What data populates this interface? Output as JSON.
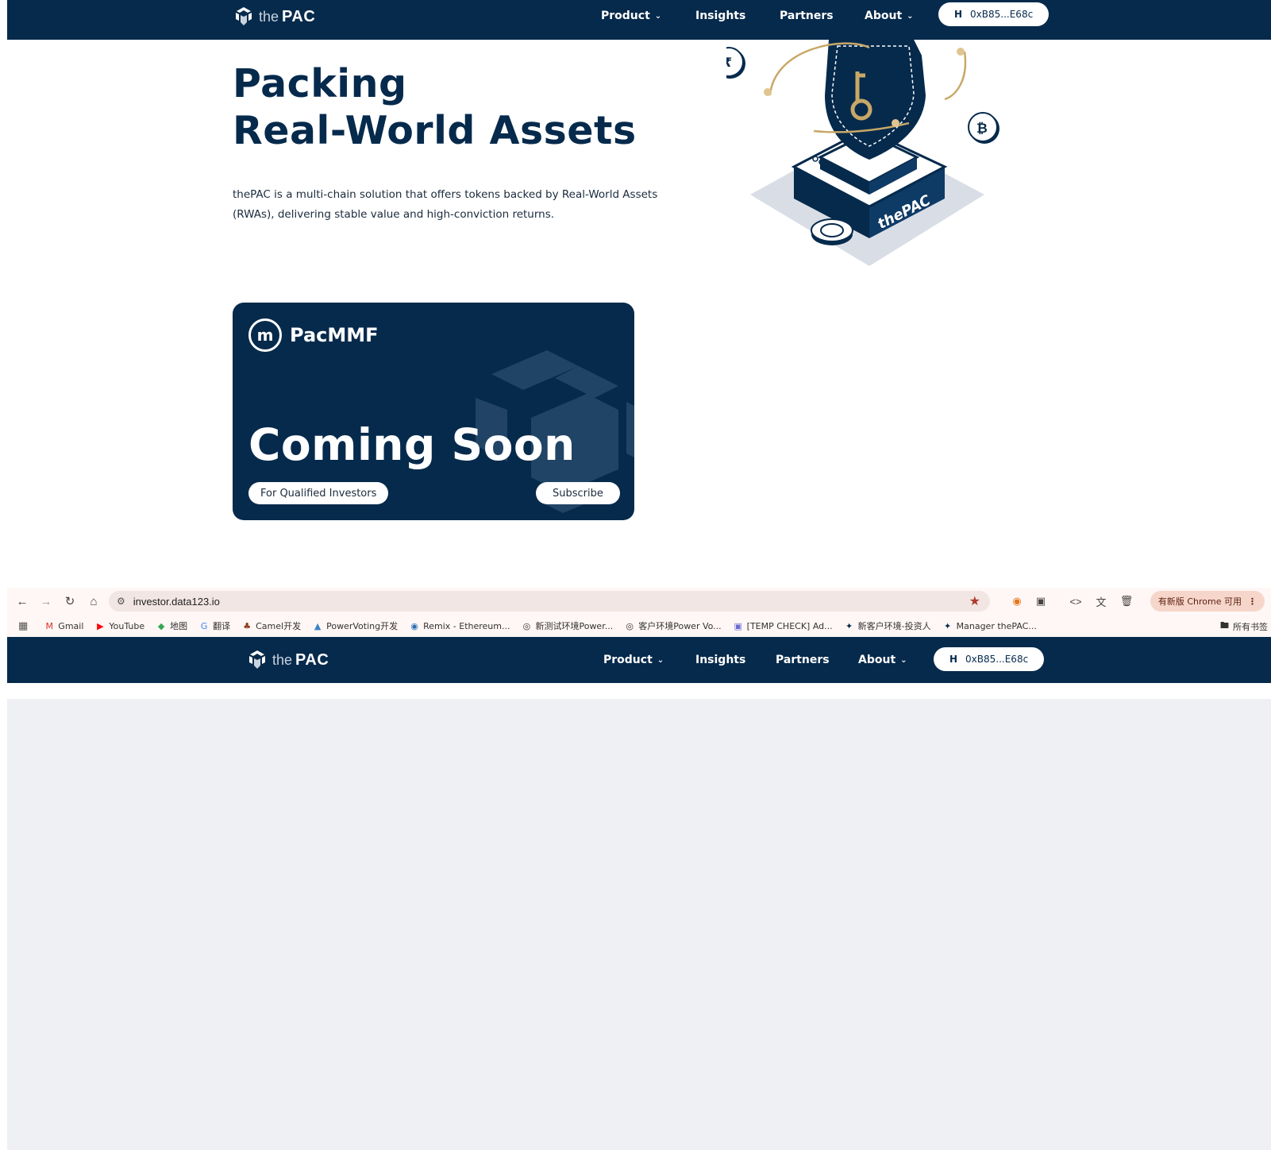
{
  "site": {
    "logo": {
      "the": "the",
      "pac": "PAC"
    },
    "nav": {
      "product": "Product",
      "insights": "Insights",
      "partners": "Partners",
      "about": "About",
      "wallet": "0xB85...E68c"
    }
  },
  "hero": {
    "title_line1": "Packing",
    "title_line2_a": "Real-World",
    "title_line2_b": "Assets",
    "description": "thePAC is a multi-chain solution that offers tokens backed by Real-World Assets (RWAs), delivering stable value and high-conviction returns.",
    "illustration_text": "thePAC"
  },
  "card": {
    "brand": "PacMMF",
    "headline": "Coming Soon",
    "qualified_label": "For Qualified Investors",
    "subscribe_label": "Subscribe"
  },
  "browser": {
    "url": "investor.data123.io",
    "update_label": "有新版 Chrome 可用",
    "bookmarks": [
      {
        "label": "Gmail",
        "icon": "gmail-icon",
        "color": "#d93025"
      },
      {
        "label": "YouTube",
        "icon": "youtube-icon",
        "color": "#ff0000"
      },
      {
        "label": "地图",
        "icon": "maps-icon",
        "color": "#34a853"
      },
      {
        "label": "翻译",
        "icon": "translate-icon",
        "color": "#4285f4"
      },
      {
        "label": "Camel开发",
        "icon": "camel-icon",
        "color": "#8b3a1a"
      },
      {
        "label": "PowerVoting开发",
        "icon": "powervoting-icon",
        "color": "#3b82c4"
      },
      {
        "label": "Remix - Ethereum...",
        "icon": "remix-icon",
        "color": "#2c6fb3"
      },
      {
        "label": "新测试环境Power...",
        "icon": "globe-icon",
        "color": "#333333"
      },
      {
        "label": "客户环境Power Vo...",
        "icon": "globe-icon",
        "color": "#333333"
      },
      {
        "label": "[TEMP CHECK] Ad...",
        "icon": "forum-icon",
        "color": "#6b6bd6"
      },
      {
        "label": "新客户环境-投资人",
        "icon": "thepac-icon",
        "color": "#062a4c"
      },
      {
        "label": "Manager thePAC...",
        "icon": "thepac-icon",
        "color": "#062a4c"
      }
    ],
    "all_bookmarks": "所有书签"
  },
  "colors": {
    "navy": "#062a4c",
    "gold": "#c8a867",
    "grey_background": "#eef0f4"
  }
}
